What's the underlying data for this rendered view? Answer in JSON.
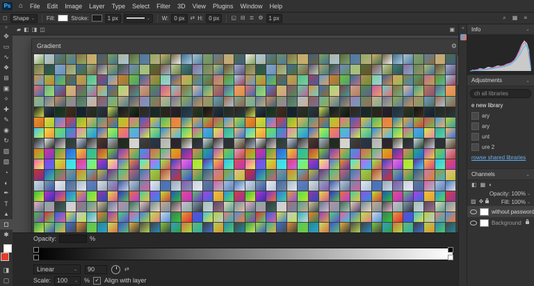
{
  "ui": {
    "caret": "⌄",
    "home_icon": "⌂",
    "collapse_chevron": "«",
    "ellipsis": "⋯"
  },
  "menubar": {
    "logo": "Ps",
    "menus": [
      "File",
      "Edit",
      "Image",
      "Layer",
      "Type",
      "Select",
      "Filter",
      "3D",
      "View",
      "Plugins",
      "Window",
      "Help"
    ]
  },
  "options": {
    "mode_label": "Shape",
    "fill_label": "Fill:",
    "stroke_label": "Stroke:",
    "stroke_width": "1 px",
    "w_label": "W:",
    "w_value": "0 px",
    "h_label": "H:",
    "h_value": "0 px",
    "extra_box": "1 px",
    "ops_icons": [
      {
        "name": "path-operations-icon",
        "glyph": "◱"
      },
      {
        "name": "path-align-icon",
        "glyph": "⊟"
      },
      {
        "name": "path-arrange-icon",
        "glyph": "≣"
      },
      {
        "name": "gear-icon",
        "glyph": "⚙"
      }
    ],
    "right_icons": [
      {
        "name": "search-icon",
        "glyph": "⌕"
      },
      {
        "name": "workspace-switcher-icon",
        "glyph": "▦"
      },
      {
        "name": "options-menu-icon",
        "glyph": "≡"
      }
    ]
  },
  "options2": {
    "left_icons": [
      {
        "name": "tool-preset-icon",
        "glyph": "▰"
      },
      {
        "name": "combine-shapes-icon",
        "glyph": "◧"
      },
      {
        "name": "path-align-icon",
        "glyph": "◨"
      },
      {
        "name": "path-arrange-icon",
        "glyph": "◫"
      }
    ],
    "right_icons": [
      {
        "name": "panel-collapse-icon",
        "glyph": "▣"
      }
    ]
  },
  "toolbar": {
    "selected_index": 18,
    "foreground_color": "#e53c28",
    "background_color": "#ffffff",
    "tools": [
      {
        "name": "move-tool",
        "glyph": "✥"
      },
      {
        "name": "marquee-tool",
        "glyph": "▭"
      },
      {
        "name": "lasso-tool",
        "glyph": "∿"
      },
      {
        "name": "quick-select-tool",
        "glyph": "❖"
      },
      {
        "name": "crop-tool",
        "glyph": "⊞"
      },
      {
        "name": "frame-tool",
        "glyph": "▣"
      },
      {
        "name": "eyedropper-tool",
        "glyph": "✧"
      },
      {
        "name": "healing-brush-tool",
        "glyph": "✚"
      },
      {
        "name": "brush-tool",
        "glyph": "✎"
      },
      {
        "name": "clone-stamp-tool",
        "glyph": "◉"
      },
      {
        "name": "history-brush-tool",
        "glyph": "↻"
      },
      {
        "name": "eraser-tool",
        "glyph": "▨"
      },
      {
        "name": "gradient-tool",
        "glyph": "▧"
      },
      {
        "name": "blur-tool",
        "glyph": "◔"
      },
      {
        "name": "dodge-tool",
        "glyph": "◐"
      },
      {
        "name": "pen-tool",
        "glyph": "✒"
      },
      {
        "name": "type-tool",
        "glyph": "T"
      },
      {
        "name": "path-select-tool",
        "glyph": "▴"
      },
      {
        "name": "shape-tool",
        "glyph": "◻"
      },
      {
        "name": "hand-tool",
        "glyph": "✱"
      },
      {
        "name": "zoom-tool",
        "glyph": "○"
      }
    ],
    "bottom_tools": [
      {
        "name": "edit-toolbar-icon",
        "glyph": "⋯"
      },
      {
        "name": "quick-mask-icon",
        "glyph": "◨"
      },
      {
        "name": "screen-mode-icon",
        "glyph": "▢"
      }
    ]
  },
  "gradient_panel": {
    "title": "Gradient",
    "gear": "⚙",
    "rows": [
      [
        "#f0f0f0",
        "#a9c9df",
        "#55809f",
        "#6e8f60",
        "#8a6e42",
        "#c7a86e",
        "#3f607f",
        "#7fa25c",
        "#aeb49e",
        "#57693a",
        "#4f7aa0",
        "#90ad62",
        "#c6b269",
        "#6e6043",
        "#41708e",
        "#a7c3d2",
        "#7e9e70",
        "#5f7f9c",
        "#bcab80",
        "#4e6c50"
      ],
      [
        "#6b7f41",
        "#30504f",
        "#7fa7c6",
        "#9e8e60",
        "#3f6e9e",
        "#8fae80",
        "#5e4f7e",
        "#ae9e70",
        "#2f5f40",
        "#6f8ebd",
        "#9ebe8e",
        "#4f6e30",
        "#7e5f40",
        "#becd9e",
        "#3f7e7e",
        "#8e6f9e",
        "#5f8e5f",
        "#aebd6e",
        "#6e4f30",
        "#9eafce"
      ],
      [
        "#d08f40",
        "#8fbe50",
        "#3f8ebe",
        "#7e5f30",
        "#bea050",
        "#4fbe8e",
        "#9e4060",
        "#5f9ece",
        "#ce7f30",
        "#6fbe40",
        "#2f6e8e",
        "#ae8e50",
        "#7ece9e",
        "#3f5f9e",
        "#de9e60",
        "#8e7e3f",
        "#4f9e6f",
        "#be6f8e",
        "#6f8e30",
        "#9ecede"
      ],
      [
        "#e07070",
        "#6fae8e",
        "#4f7fce",
        "#cebe60",
        "#8e4f6e",
        "#5fce9e",
        "#de8e40",
        "#3f6eae",
        "#9ede6f",
        "#7e3f4f",
        "#ce9e8e",
        "#4f8e4f",
        "#be5f9e",
        "#6fcece",
        "#8e6f30",
        "#debe8e",
        "#3f9e8e",
        "#ae7e5f",
        "#5f5f8e",
        "#ee9e6e"
      ],
      [
        "#9eae7e",
        "#5f7e9e",
        "#ce8e5f",
        "#7e9e5f",
        "#4f6e5f",
        "#aebece",
        "#8e5f4f",
        "#6eae9e",
        "#bea97e",
        "#3f5f7e",
        "#9e7eae",
        "#5f8e6e",
        "#ceae8e",
        "#7e6e9e",
        "#8eae4f",
        "#4f7e8e",
        "#ae8e6e",
        "#6e9ebe",
        "#9e6e4f",
        "#7eae8e"
      ],
      [
        "#1e1e1e",
        "#2e3e4e",
        "#0f2f1f",
        "#3e2e1e",
        "#12202e",
        "#2f2f2f",
        "#1f3f3f",
        "#cedd4f",
        "#101820",
        "#243820",
        "#32241a",
        "#16262f",
        "#202a18",
        "#2b1e2e",
        "#18303c",
        "#3a3222",
        "#101010",
        "#26333b",
        "#1c2b22",
        "#30201c"
      ],
      [
        "#ef8e30",
        "#efcf40",
        "#3f8fe0",
        "#e04030",
        "#6fbf40",
        "#efaf60",
        "#30a0a0",
        "#cf6f20",
        "#9fcf30",
        "#ef6f90",
        "#4060cf",
        "#efc020",
        "#50b070",
        "#e08050",
        "#2080c0",
        "#f0a030",
        "#80c050",
        "#d05060",
        "#40a0e0",
        "#c0d040"
      ],
      [
        "#40c0ef",
        "#efe040",
        "#70e050",
        "#20a0c0",
        "#f080b0",
        "#60d0a0",
        "#3070e0",
        "#c0ef50",
        "#ef9040",
        "#50c0c0",
        "#9060d0",
        "#b0e070",
        "#2090e0",
        "#efb050",
        "#40d080",
        "#e060a0",
        "#60a0f0",
        "#d0ef40",
        "#30b0a0",
        "#f0c070"
      ],
      [
        "#2a2a2a",
        "#e8e8e8",
        "#383850",
        "#204030",
        "#c8c8d8",
        "#303030",
        "#503828",
        "#a8b8c8",
        "#202820",
        "#d8d0c0",
        "#404048",
        "#283848",
        "#b0b0b0",
        "#302030",
        "#484838",
        "#223022",
        "#d0d8e0",
        "#383028",
        "#28303c",
        "#c0c8b8"
      ],
      [
        "#ef7020",
        "#e030a0",
        "#40b040",
        "#3060e0",
        "#efd030",
        "#20c0b0",
        "#c04040",
        "#80d030",
        "#7040c0",
        "#efa040",
        "#30a0e0",
        "#e06060",
        "#50c070",
        "#d0b020",
        "#4040a0",
        "#ef8060",
        "#20b080",
        "#b050d0",
        "#90c040",
        "#e0a0c0"
      ],
      [
        "#ef60b0",
        "#9040e0",
        "#b0ef40",
        "#40d0ef",
        "#e04070",
        "#60efb0",
        "#c030c0",
        "#eff060",
        "#5070ef",
        "#ef9030",
        "#40efe0",
        "#d060ef",
        "#8fef50",
        "#3040c0",
        "#ef70e0",
        "#b0e030",
        "#6030a0",
        "#efc050",
        "#30c0f0",
        "#e05050"
      ],
      [
        "#d03030",
        "#3050d0",
        "#30a050",
        "#909090",
        "#e08030",
        "#50b0d0",
        "#c0c030",
        "#703090",
        "#40c090",
        "#d06080",
        "#3080b0",
        "#a0d050",
        "#b05030",
        "#5050b0",
        "#80b080",
        "#d0a060",
        "#306080",
        "#c080b0",
        "#90a030",
        "#e0c090"
      ],
      [
        "#c8d8e8",
        "#8098b0",
        "#e8e8f0",
        "#4868a0",
        "#a8b8c8",
        "#6080c0",
        "#d8e0e8",
        "#90a8c0",
        "#3858a8",
        "#b8c8d8",
        "#7088a8",
        "#e0e8f0",
        "#5070b0",
        "#98a8b8",
        "#8858b0",
        "#c8d0e0",
        "#6078a0",
        "#d860a0",
        "#a8c0d8",
        "#4878c0"
      ],
      [
        "#30c030",
        "#c030c0",
        "#7030e0",
        "#3070e0",
        "#e0a030",
        "#50e050",
        "#a030a0",
        "#e0e040",
        "#3030c0",
        "#ef7030",
        "#40d0a0",
        "#9050e0",
        "#c0e030",
        "#2050c0",
        "#e05090",
        "#60c060",
        "#b040e0",
        "#efc040",
        "#3090e0",
        "#d04040"
      ],
      [
        "#e8b0c0",
        "#80b0a0",
        "#303840",
        "#c0d0e0",
        "#a07080",
        "#50a090",
        "#d8c0a0",
        "#607890",
        "#b890a8",
        "#406858",
        "#e0d0c0",
        "#708898",
        "#c8a890",
        "#385048",
        "#d0b8d0",
        "#8098a8",
        "#a8c0b0",
        "#584868",
        "#e8d8b8",
        "#7890a0"
      ],
      [
        "#40c040",
        "#e03030",
        "#3060e0",
        "#e0e040",
        "#c0c8d0",
        "#30b0b0",
        "#ef8030",
        "#9040c0",
        "#50d080",
        "#e060a0",
        "#4080e0",
        "#c0e050",
        "#d0d8e0",
        "#308050",
        "#e0a040",
        "#6050d0",
        "#40c0e0",
        "#b0d040",
        "#e08080",
        "#5090e0"
      ],
      [
        "#30a040",
        "#a0e040",
        "#30b0a0",
        "#4070d0",
        "#e09030",
        "#50c860",
        "#208898",
        "#c8e060",
        "#3858c8",
        "#e0b040",
        "#484848",
        "#404040",
        "#78c840",
        "#30a0c8",
        "#d87040",
        "#60b878",
        "#3c3c3c",
        "#b0cf50",
        "#2888b8",
        "#444444"
      ]
    ]
  },
  "editor": {
    "opacity_label": "Opacity:",
    "opacity_value": "",
    "percent": "%",
    "ramp_start": "#000000",
    "ramp_end": "#ffffff",
    "type_value": "Linear",
    "angle_value": "90",
    "scale_label": "Scale:",
    "scale_value": "100",
    "align_label": "Align with layer"
  },
  "rightpanel": {
    "info_title": "Info",
    "adjustments_title": "Adjustments",
    "search_text": "ch all libraries",
    "create_library": "e new library",
    "library_items": [
      "ary",
      "ary",
      "unt",
      "ure 2"
    ],
    "browse_link": "rowse shared libraries",
    "channels_title": "Channels",
    "layers_icons": [
      {
        "name": "filter-type-icon",
        "glyph": "◧"
      },
      {
        "name": "filter-pixel-icon",
        "glyph": "▦"
      },
      {
        "name": "filter-adjust-icon",
        "glyph": "◐"
      }
    ],
    "lock_icons": [
      {
        "name": "lock-transparency-icon",
        "glyph": "▨"
      },
      {
        "name": "lock-position-icon",
        "glyph": "✥"
      }
    ],
    "layers": {
      "opacity_text": "Opacity: 100%",
      "fill_text": "Fill: 100%",
      "layer1": "without password",
      "layer2": "Background"
    }
  }
}
